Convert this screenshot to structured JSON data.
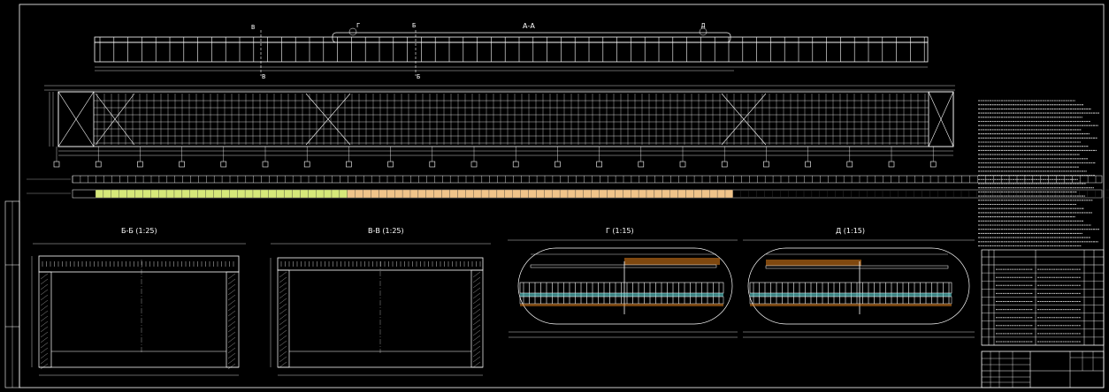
{
  "labels": {
    "section_aa": "А-А",
    "cut_b": "Б",
    "cut_v": "В",
    "mark_g": "Г",
    "mark_d": "Д",
    "section_bb": "Б-Б (1:25)",
    "section_vv": "В-В (1:25)",
    "detail_g": "Г (1:15)",
    "detail_d": "Д (1:15)"
  },
  "colors": {
    "background": "#000000",
    "line": "#ffffff",
    "strip_green": "#d6e87a",
    "strip_orange": "#f0c48a",
    "detail_orange": "#e8841c",
    "detail_cyan": "#5fd6d6"
  },
  "table_rows": 10
}
